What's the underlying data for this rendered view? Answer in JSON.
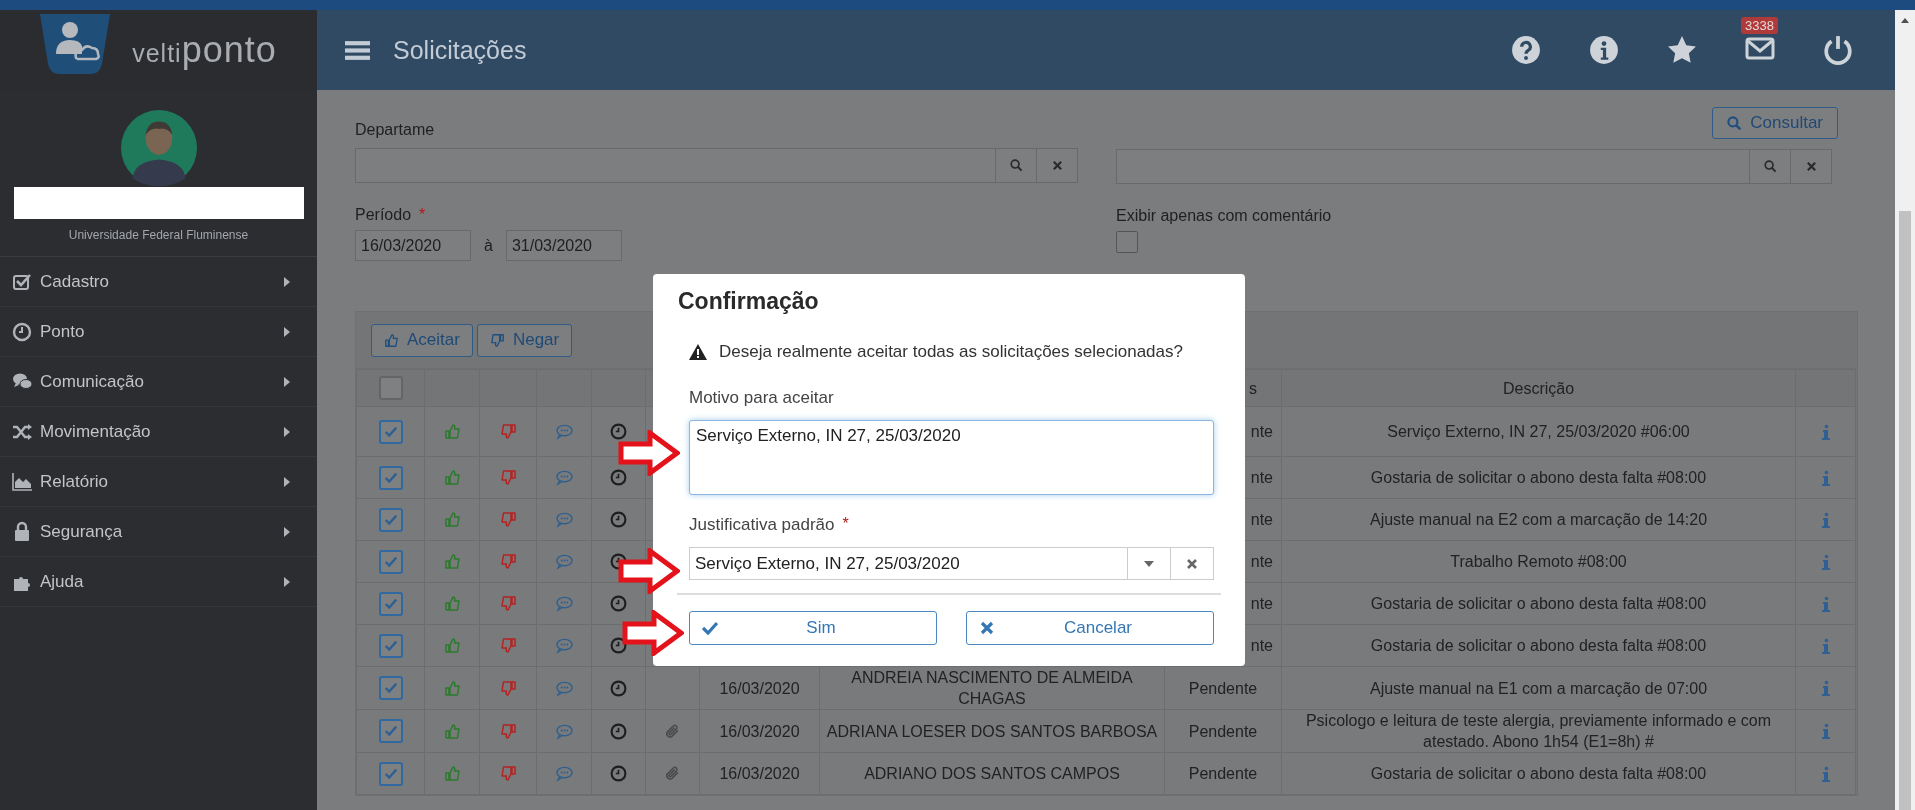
{
  "sidebar": {
    "logo": {
      "prefix": "velti",
      "name": "ponto"
    },
    "organization": "Universidade Federal Fluminense",
    "menu": [
      {
        "label": "Cadastro"
      },
      {
        "label": "Ponto"
      },
      {
        "label": "Comunicação"
      },
      {
        "label": "Movimentação"
      },
      {
        "label": "Relatório"
      },
      {
        "label": "Segurança"
      },
      {
        "label": "Ajuda"
      }
    ]
  },
  "header": {
    "title": "Solicitações",
    "mail_count": "3338"
  },
  "filters": {
    "department_label": "Departame",
    "search_button": "Consultar",
    "period_label": "Período",
    "required_mark": "*",
    "period_start": "16/03/2020",
    "period_separator": "à",
    "period_end": "31/03/2020",
    "comment_only_label": "Exibir apenas com comentário",
    "comment_only_checked": false
  },
  "table": {
    "actions": [
      "Aceitar",
      "Negar"
    ],
    "select_all_checked": false,
    "columns": [
      {
        "label": "s",
        "covered": true
      },
      {
        "label": "Descrição",
        "covered": false
      }
    ],
    "rows": [
      {
        "checked": true,
        "attachment": false,
        "status": "nte",
        "status_covered": true,
        "description": "Serviço Externo, IN 27, 25/03/2020 #06:00"
      },
      {
        "checked": true,
        "attachment": false,
        "status": "nte",
        "status_covered": true,
        "description": "Gostaria de solicitar o abono desta falta #08:00"
      },
      {
        "checked": true,
        "attachment": false,
        "status": "nte",
        "status_covered": true,
        "description": "Ajuste manual na E2 com a marcação de 14:20"
      },
      {
        "checked": true,
        "attachment": false,
        "status": "nte",
        "status_covered": true,
        "description": "Trabalho Remoto #08:00"
      },
      {
        "checked": true,
        "attachment": false,
        "status": "nte",
        "status_covered": true,
        "description": "Gostaria de solicitar o abono desta falta #08:00"
      },
      {
        "checked": true,
        "attachment": false,
        "status": "nte",
        "status_covered": true,
        "description": "Gostaria de solicitar o abono desta falta #08:00"
      },
      {
        "checked": true,
        "attachment": false,
        "date": "16/03/2020",
        "name": "ANDREIA NASCIMENTO DE ALMEIDA CHAGAS",
        "status": "Pendente",
        "status_covered": false,
        "description": "Ajuste manual na E1 com a marcação de 07:00"
      },
      {
        "checked": true,
        "attachment": true,
        "date": "16/03/2020",
        "name": "ADRIANA LOESER DOS SANTOS BARBOSA",
        "status": "Pendente",
        "status_covered": false,
        "description": "Psicologo e leitura de teste alergia, previamente informado e com atestado. Abono 1h54 (E1=8h) #"
      },
      {
        "checked": true,
        "attachment": true,
        "date": "16/03/2020",
        "name": "ADRIANO DOS SANTOS CAMPOS",
        "status": "Pendente",
        "status_covered": false,
        "description": "Gostaria de solicitar o abono desta falta #08:00"
      }
    ]
  },
  "dialog": {
    "title": "Confirmação",
    "message": "Deseja realmente aceitar todas as solicitações selecionadas?",
    "reason_label": "Motivo para aceitar",
    "reason_value": "Serviço Externo, IN 27, 25/03/2020",
    "justification_label": "Justificativa padrão",
    "required_mark": "*",
    "justification_value": "Serviço Externo, IN 27, 25/03/2020",
    "buttons": [
      "Sim",
      "Cancelar"
    ]
  }
}
